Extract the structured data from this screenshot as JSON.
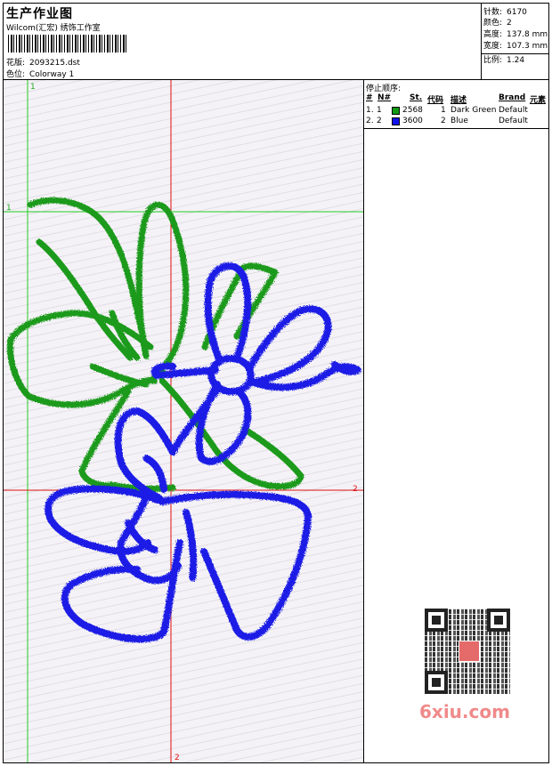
{
  "header": {
    "title": "生产作业图",
    "studio": "Wilcom(汇宏) 绣饰工作室",
    "design_label": "花版:",
    "design_value": "2093215.dst",
    "colorway_label": "色位:",
    "colorway_value": "Colorway 1"
  },
  "stats": [
    {
      "label": "针数:",
      "value": "6170"
    },
    {
      "label": "颜色:",
      "value": "2"
    },
    {
      "label": "高度:",
      "value": "137.8 mm"
    },
    {
      "label": "宽度:",
      "value": "107.3 mm"
    },
    {
      "label": "比例:",
      "value": "1.24"
    }
  ],
  "stop_panel": {
    "title": "停止顺序:",
    "headers": {
      "idx": "#",
      "n": "N#",
      "st": "St.",
      "code": "代码",
      "desc": "描述",
      "brand": "Brand",
      "element": "元素"
    },
    "rows": [
      {
        "idx": "1.",
        "n": "1",
        "st": "2568",
        "code": "1",
        "desc": "Dark Green",
        "brand": "Default",
        "color": "#119911"
      },
      {
        "idx": "2.",
        "n": "2",
        "st": "3600",
        "code": "2",
        "desc": "Blue",
        "brand": "Default",
        "color": "#1111ee"
      }
    ]
  },
  "guides": {
    "green_v_label": "1",
    "green_h_label": "1",
    "red_h_label": "2",
    "red_v_label": "2"
  },
  "thread_colors": {
    "green": "#1f9a1a",
    "blue": "#1a1ae6",
    "red_guide": "#e01010",
    "green_guide": "#22cc22"
  },
  "watermark": {
    "text": "6xiu.com"
  }
}
